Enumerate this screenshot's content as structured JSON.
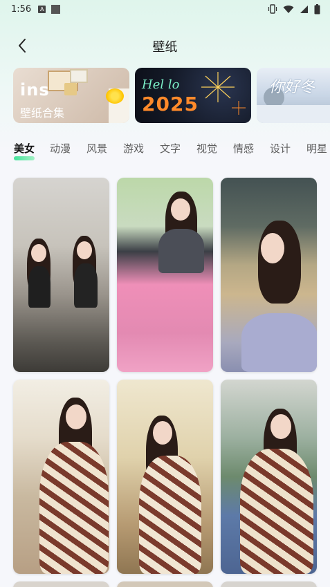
{
  "status_bar": {
    "time": "1:56",
    "notification_icon_letter": "A",
    "icons": [
      "vibrate-icon",
      "wifi-icon",
      "signal-icon",
      "battery-icon"
    ]
  },
  "header": {
    "title": "壁纸",
    "back_icon": "chevron-left-icon"
  },
  "banners": [
    {
      "logo": "ins",
      "subtitle": "壁纸合集"
    },
    {
      "hello": "Hel lo",
      "year": "2025"
    },
    {
      "text": "你好冬"
    }
  ],
  "tabs": [
    {
      "label": "美女",
      "active": true
    },
    {
      "label": "动漫",
      "active": false
    },
    {
      "label": "风景",
      "active": false
    },
    {
      "label": "游戏",
      "active": false
    },
    {
      "label": "文字",
      "active": false
    },
    {
      "label": "视觉",
      "active": false
    },
    {
      "label": "情感",
      "active": false
    },
    {
      "label": "设计",
      "active": false
    },
    {
      "label": "明星",
      "active": false
    }
  ],
  "colors": {
    "accent": "#2fe08f",
    "tab_active": "#111111",
    "tab_inactive": "#5f5f5f"
  },
  "grid": {
    "item_count_visible": 9
  }
}
